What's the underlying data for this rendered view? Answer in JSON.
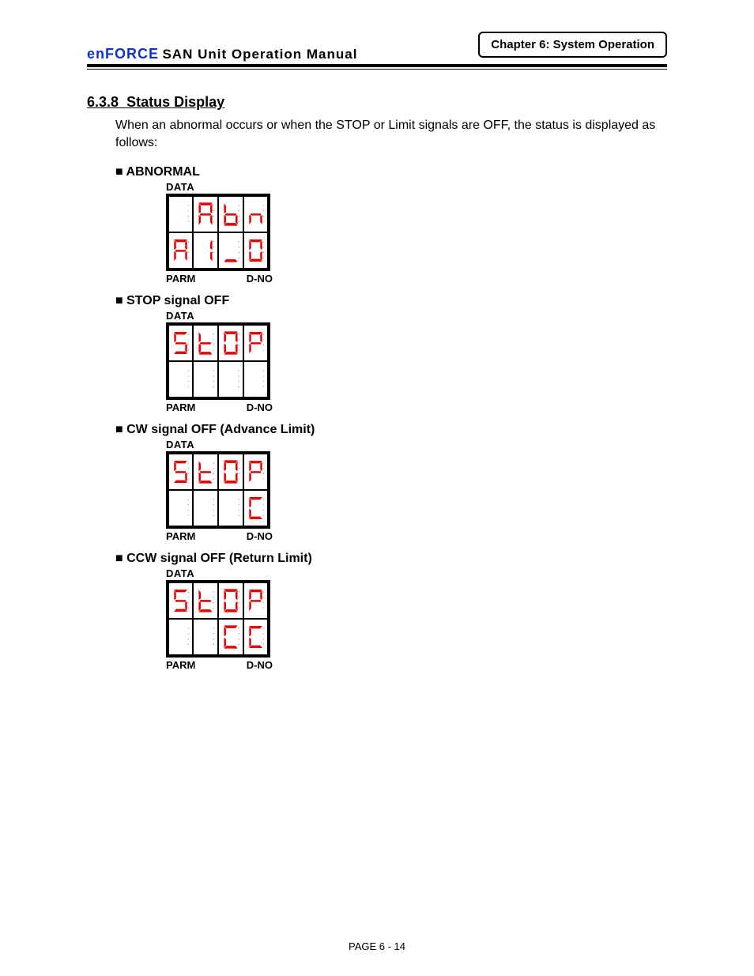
{
  "header": {
    "brand": "enFORCE",
    "manual_title": "SAN Unit Operation Manual",
    "chapter": "Chapter 6: System Operation"
  },
  "section": {
    "number": "6.3.8",
    "title": "Status Display",
    "intro": "When an abnormal occurs or when the STOP or Limit signals are OFF, the status is displayed as follows:"
  },
  "labels": {
    "data": "DATA",
    "parm": "PARM",
    "dno": "D-NO"
  },
  "displays": [
    {
      "title": "ABNORMAL",
      "top_row": [
        " ",
        "A",
        "b",
        "n"
      ],
      "bottom_row": [
        "A",
        "1",
        "_",
        "0"
      ]
    },
    {
      "title": "STOP signal OFF",
      "top_row": [
        "S",
        "t",
        "0",
        "P"
      ],
      "bottom_row": [
        " ",
        " ",
        " ",
        " "
      ]
    },
    {
      "title": "CW signal OFF (Advance Limit)",
      "top_row": [
        "S",
        "t",
        "0",
        "P"
      ],
      "bottom_row": [
        " ",
        " ",
        " ",
        "C"
      ]
    },
    {
      "title": "CCW signal OFF (Return Limit)",
      "top_row": [
        "S",
        "t",
        "0",
        "P"
      ],
      "bottom_row": [
        " ",
        " ",
        "C",
        "C"
      ]
    }
  ],
  "footer": "PAGE 6 - 14"
}
